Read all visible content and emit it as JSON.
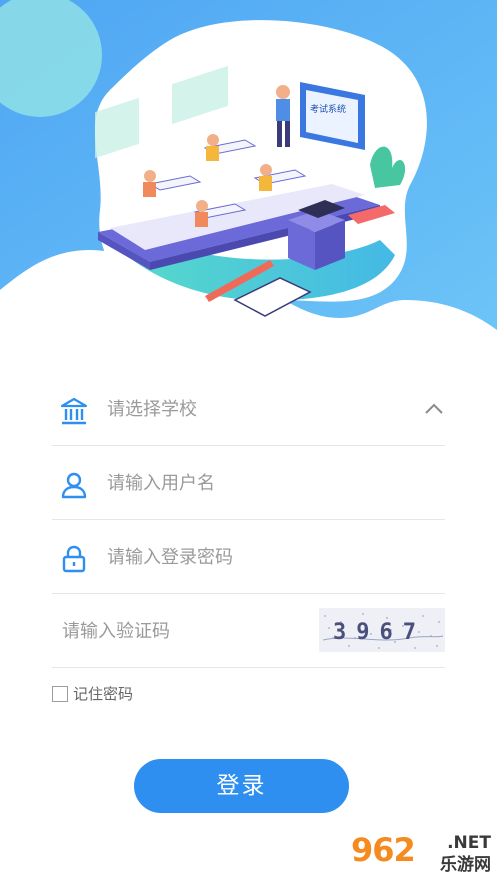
{
  "hero": {
    "screen_label": "考试系统",
    "colors": {
      "sky": "#5aaef5",
      "blob": "#ffffff",
      "platform": "#7b77e6",
      "ground": "#4fd2c6"
    }
  },
  "form": {
    "school": {
      "placeholder": "请选择学校",
      "icon": "bank-icon",
      "expand_icon": "chevron-up-icon"
    },
    "username": {
      "placeholder": "请输入用户名",
      "icon": "user-icon"
    },
    "password": {
      "placeholder": "请输入登录密码",
      "icon": "lock-icon"
    },
    "captcha": {
      "placeholder": "请输入验证码",
      "code": "3967"
    }
  },
  "remember": {
    "label": "记住密码",
    "checked": false
  },
  "login": {
    "label": "登录",
    "color": "#2e8ff0"
  },
  "watermark": {
    "logo": "962",
    "net": ".NET",
    "cn": "乐游网"
  }
}
